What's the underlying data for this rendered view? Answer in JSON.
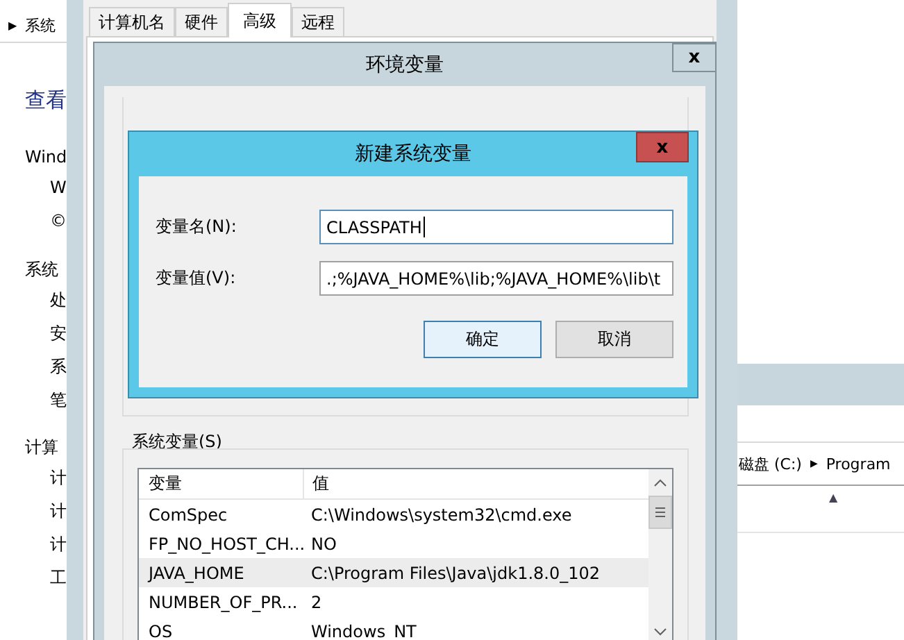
{
  "background_window": {
    "breadcrumb": {
      "arrow": "▶",
      "label": "系统"
    },
    "heading": "查看",
    "sections": [
      {
        "text": "Wind",
        "children": [
          {
            "text": "W"
          },
          {
            "text": "©"
          }
        ]
      },
      {
        "text": "系统",
        "children": [
          {
            "text": "处"
          },
          {
            "text": "安"
          },
          {
            "text": "系"
          },
          {
            "text": "笔"
          }
        ]
      },
      {
        "text": "计算",
        "children": [
          {
            "text": "计"
          },
          {
            "text": "计"
          },
          {
            "text": "计"
          },
          {
            "text": "工"
          }
        ]
      }
    ]
  },
  "explorer": {
    "breadcrumb": [
      "磁盘 (C:)",
      "Program"
    ],
    "separator": "▶",
    "sort_indicator": "▲"
  },
  "system_properties": {
    "tabs": [
      {
        "label": "计算机名",
        "selected": false
      },
      {
        "label": "硬件",
        "selected": false
      },
      {
        "label": "高级",
        "selected": true
      },
      {
        "label": "远程",
        "selected": false
      }
    ]
  },
  "environment_variables": {
    "title": "环境变量",
    "close": "x",
    "system_variables": {
      "label": "系统变量(S)",
      "columns": [
        "变量",
        "值"
      ],
      "rows": [
        {
          "name": "ComSpec",
          "value": "C:\\Windows\\system32\\cmd.exe",
          "selected": false
        },
        {
          "name": "FP_NO_HOST_CH...",
          "value": "NO",
          "selected": false
        },
        {
          "name": "JAVA_HOME",
          "value": "C:\\Program Files\\Java\\jdk1.8.0_102",
          "selected": true
        },
        {
          "name": "NUMBER_OF_PR...",
          "value": "2",
          "selected": false
        },
        {
          "name": "OS",
          "value": "Windows_NT",
          "selected": false
        }
      ]
    }
  },
  "new_variable_dialog": {
    "title": "新建系统变量",
    "close": "x",
    "fields": [
      {
        "label": "变量名(N):",
        "value": "CLASSPATH",
        "focused": true
      },
      {
        "label": "变量值(V):",
        "value": ".;%JAVA_HOME%\\lib;%JAVA_HOME%\\lib\\t",
        "focused": false
      }
    ],
    "buttons": [
      {
        "label": "确定",
        "default": true
      },
      {
        "label": "取消",
        "default": false
      }
    ]
  }
}
